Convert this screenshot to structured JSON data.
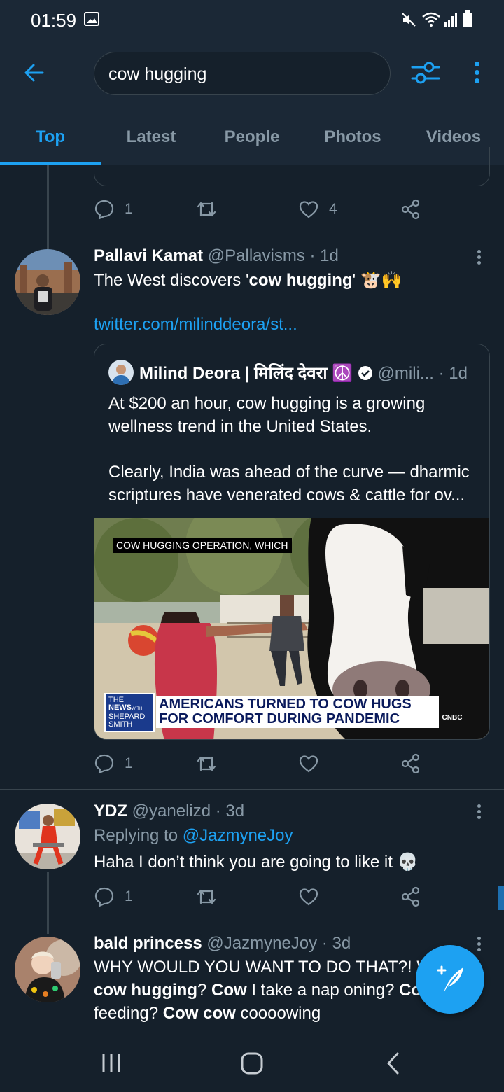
{
  "status_bar": {
    "time": "01:59"
  },
  "search": {
    "query": "cow hugging"
  },
  "tabs": [
    {
      "label": "Top",
      "active": true
    },
    {
      "label": "Latest",
      "active": false
    },
    {
      "label": "People",
      "active": false
    },
    {
      "label": "Photos",
      "active": false
    },
    {
      "label": "Videos",
      "active": false
    }
  ],
  "prev_tweet": {
    "replies": "1",
    "likes": "4"
  },
  "tweet1": {
    "name": "Pallavi Kamat",
    "handle": "@Pallavisms",
    "time": "· 1d",
    "text_before": "The West discovers '",
    "text_bold": "cow hugging",
    "text_after": "' 🐮🙌",
    "link": "twitter.com/milinddeora/st...",
    "quote": {
      "name": "Milind Deora | मिलिंद देवरा ☮️",
      "handle": "@mili...",
      "time": "· 1d",
      "text1": "At $200 an hour, cow hugging is a growing wellness trend in the United States.",
      "text2": "Clearly, India was ahead of the curve — dharmic scriptures have venerated cows & cattle for ov...",
      "media_caption": "COW HUGGING OPERATION, WHICH",
      "news_logo_line1": "THE",
      "news_logo_line2": "NEWS",
      "news_logo_with": "WITH",
      "news_logo_line3": "SHEPARD",
      "news_logo_line4": "SMITH",
      "headline1": "AMERICANS TURNED TO COW HUGS",
      "headline2": "FOR COMFORT DURING PANDEMIC",
      "network": "CNBC"
    },
    "replies": "1"
  },
  "tweet2": {
    "name": "YDZ",
    "handle": "@yanelizd",
    "time": "· 3d",
    "replying_prefix": "Replying to ",
    "replying_to": "@JazmyneJoy",
    "text": "Haha I don’t think you are going to like it 💀",
    "replies": "1"
  },
  "tweet3": {
    "name": "bald princess",
    "handle": "@JazmyneJoy",
    "time": "· 3d",
    "line1": "WHY WOULD YOU WANT TO DO THAT?! WH",
    "line2_bold1": "cow hugging",
    "line2_mid": "? ",
    "line2_bold2": "Cow",
    "line2_rest": " I take a nap oning? ",
    "line2_bold3": "Cow",
    "line3_pre": "feeding? ",
    "line3_bold": "Cow cow",
    "line3_rest": " coooowing"
  },
  "colors": {
    "accent": "#1da1f2",
    "background": "#15202b",
    "bar": "#1b2836",
    "muted": "#8899a6",
    "border": "#38444d"
  }
}
